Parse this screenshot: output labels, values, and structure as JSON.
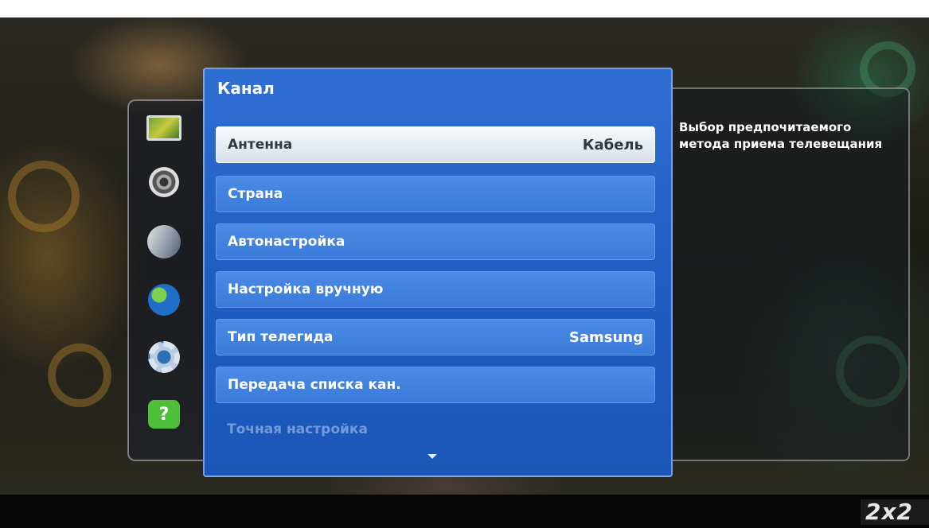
{
  "menu": {
    "title": "Канал",
    "items": [
      {
        "label": "Антенна",
        "value": "Кабель"
      },
      {
        "label": "Страна",
        "value": ""
      },
      {
        "label": "Автонастройка",
        "value": ""
      },
      {
        "label": "Настройка вручную",
        "value": ""
      },
      {
        "label": "Тип телегида",
        "value": "Samsung"
      },
      {
        "label": "Передача списка кан.",
        "value": ""
      },
      {
        "label": "Точная настройка",
        "value": ""
      }
    ]
  },
  "help": {
    "text": "Выбор предпочитаемого метода приема телевещания"
  },
  "sidebar": {
    "icons": [
      "picture-icon",
      "sound-icon",
      "channel-icon",
      "network-icon",
      "system-icon",
      "support-icon"
    ],
    "support_glyph": "?"
  },
  "watermark": {
    "text": "2x2"
  },
  "colors": {
    "menu_blue": "#215fc4",
    "item_blue": "#3a7ad9",
    "selected_bg": "#eef2f6"
  }
}
